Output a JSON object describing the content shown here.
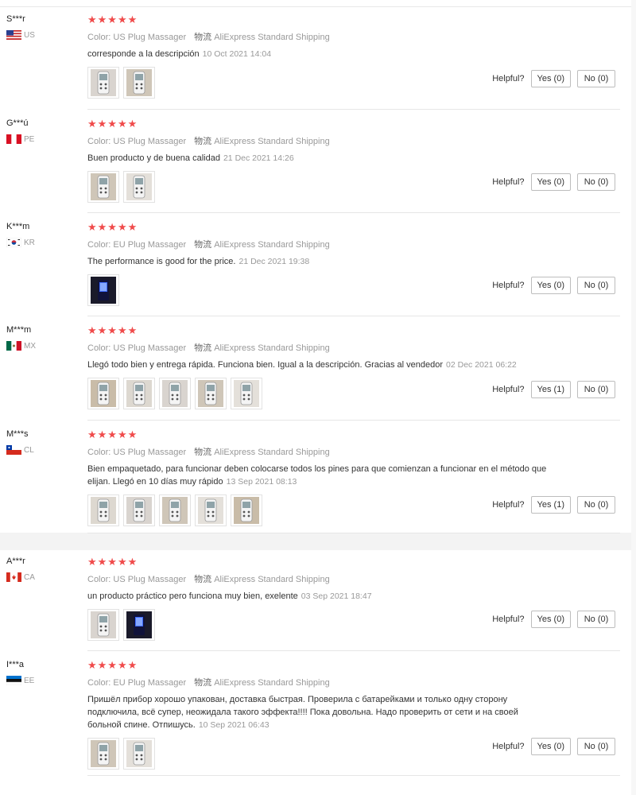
{
  "helpful_label": "Helpful?",
  "meta_labels": {
    "color": "Color:",
    "shipping": "物流"
  },
  "reviews": [
    {
      "user": "S***r",
      "country": "US",
      "flag": "us",
      "stars": "★★★★★",
      "color": "US Plug Massager",
      "shipping": "AliExpress Standard Shipping",
      "text": "corresponde a la descripción",
      "date": "10 Oct 2021 14:04",
      "yes": "Yes (0)",
      "no": "No (0)",
      "photos": [
        "device-photo",
        "device-photo"
      ]
    },
    {
      "user": "G***ú",
      "country": "PE",
      "flag": "pe",
      "stars": "★★★★★",
      "color": "US Plug Massager",
      "shipping": "AliExpress Standard Shipping",
      "text": "Buen producto y de buena calidad",
      "date": "21 Dec 2021 14:26",
      "yes": "Yes (0)",
      "no": "No (0)",
      "photos": [
        "device-photo",
        "device-photo"
      ]
    },
    {
      "user": "K***m",
      "country": "KR",
      "flag": "kr",
      "stars": "★★★★★",
      "color": "EU Plug Massager",
      "shipping": "AliExpress Standard Shipping",
      "text": "The performance is good for the price.",
      "date": "21 Dec 2021 19:38",
      "yes": "Yes (0)",
      "no": "No (0)",
      "photos": [
        "device-photo-blue"
      ]
    },
    {
      "user": "M***m",
      "country": "MX",
      "flag": "mx",
      "stars": "★★★★★",
      "color": "US Plug Massager",
      "shipping": "AliExpress Standard Shipping",
      "text": "Llegó todo bien y entrega rápida. Funciona bien. Igual a la descripción. Gracias al vendedor",
      "date": "02 Dec 2021 06:22",
      "yes": "Yes (1)",
      "no": "No (0)",
      "photos": [
        "device-photo",
        "device-photo",
        "device-photo",
        "device-photo",
        "device-photo"
      ]
    },
    {
      "user": "M***s",
      "country": "CL",
      "flag": "cl",
      "stars": "★★★★★",
      "color": "US Plug Massager",
      "shipping": "AliExpress Standard Shipping",
      "text": "Bien empaquetado, para funcionar deben colocarse todos los pines para que comienzan a funcionar en el método que elijan. Llegó en 10 días muy rápido",
      "date": "13 Sep 2021 08:13",
      "yes": "Yes (1)",
      "no": "No (0)",
      "photos": [
        "device-photo",
        "device-photo",
        "device-photo",
        "device-photo",
        "device-photo"
      ]
    },
    {
      "user": "A***r",
      "country": "CA",
      "flag": "ca",
      "stars": "★★★★★",
      "color": "US Plug Massager",
      "shipping": "AliExpress Standard Shipping",
      "text": "un producto práctico pero funciona muy bien, exelente",
      "date": "03 Sep 2021 18:47",
      "yes": "Yes (0)",
      "no": "No (0)",
      "photos": [
        "device-photo",
        "device-photo-blue"
      ]
    },
    {
      "user": "I***a",
      "country": "EE",
      "flag": "ee",
      "stars": "★★★★★",
      "color": "EU Plug Massager",
      "shipping": "AliExpress Standard Shipping",
      "text": "Пришёл прибор хорошо упакован, доставка быстрая. Проверила с батарейками и только одну сторону подключила, всё супер, неожидала такого эффекта!!!! Пока довольна. Надо проверить от сети и на своей больной спине. Отпишусь.",
      "date": "10 Sep 2021 06:43",
      "yes": "Yes (0)",
      "no": "No (0)",
      "photos": [
        "device-photo",
        "device-photo"
      ]
    }
  ]
}
